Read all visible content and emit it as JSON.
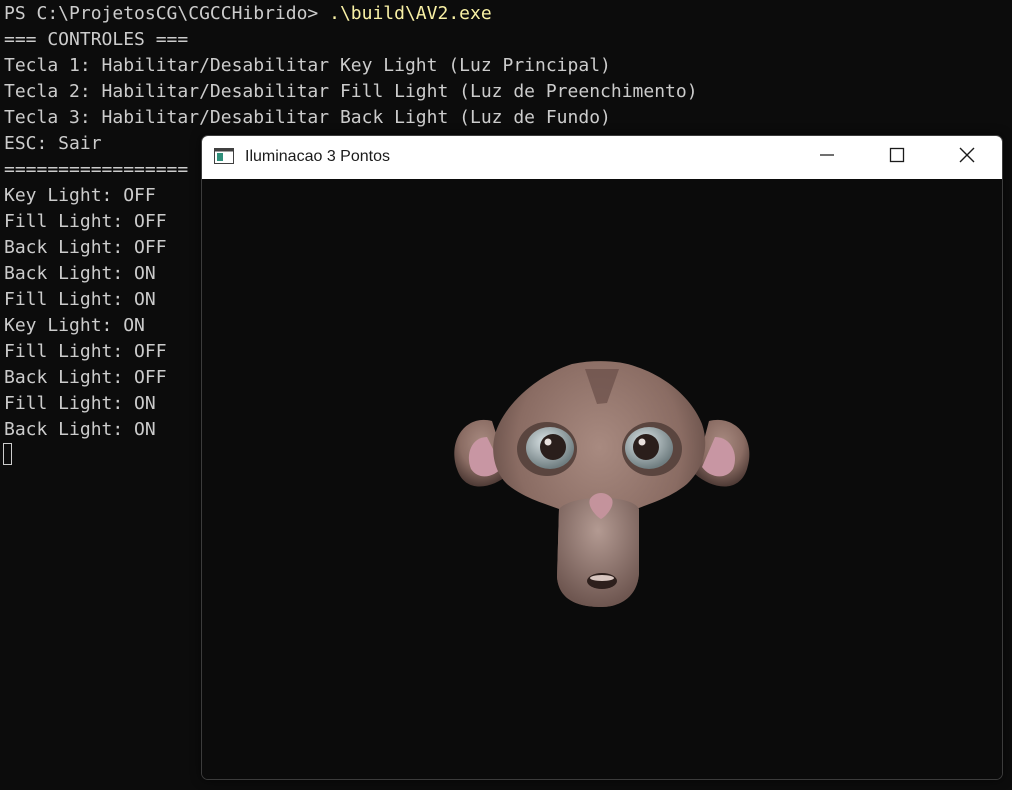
{
  "terminal": {
    "prompt": "PS C:\\ProjetosCG\\CGCCHibrido> ",
    "command": ".\\build\\AV2.exe",
    "lines": [
      "=== CONTROLES ===",
      "Tecla 1: Habilitar/Desabilitar Key Light (Luz Principal)",
      "Tecla 2: Habilitar/Desabilitar Fill Light (Luz de Preenchimento)",
      "Tecla 3: Habilitar/Desabilitar Back Light (Luz de Fundo)",
      "ESC: Sair",
      "=================",
      "Key Light: OFF",
      "Fill Light: OFF",
      "Back Light: OFF",
      "Back Light: ON",
      "Fill Light: ON",
      "Key Light: ON",
      "Fill Light: OFF",
      "Back Light: OFF",
      "Fill Light: ON",
      "Back Light: ON"
    ],
    "colors": {
      "background": "#0c0c0c",
      "text": "#cccccc",
      "command": "#f9f1a5"
    }
  },
  "window": {
    "title": "Iluminacao 3 Pontos",
    "icons": [
      "app-window-icon",
      "minimize-icon",
      "maximize-icon",
      "close-icon"
    ],
    "viewport_content": "suzanne-monkey-head-3d-model",
    "colors": {
      "titlebar": "#ffffff",
      "viewport": "#0b0b0b",
      "model": "#8c6e66"
    }
  }
}
